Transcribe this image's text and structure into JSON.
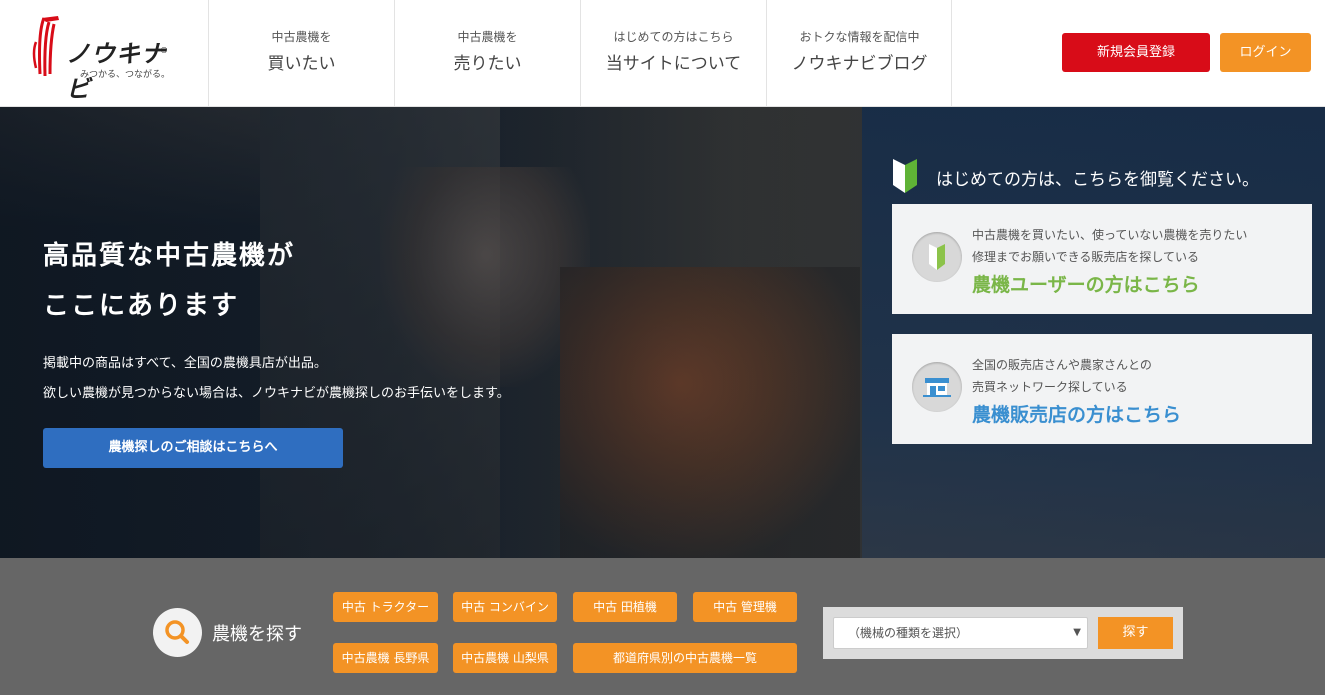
{
  "header": {
    "logo_text": "ノウキナビ",
    "logo_reg": "®",
    "logo_tagline": "みつかる、つながる。",
    "nav": [
      {
        "small": "中古農機を",
        "big": "買いたい"
      },
      {
        "small": "中古農機を",
        "big": "売りたい"
      },
      {
        "small": "はじめての方はこちら",
        "big": "当サイトについて"
      },
      {
        "small": "おトクな情報を配信中",
        "big": "ノウキナビブログ"
      }
    ],
    "register_label": "新規会員登録",
    "login_label": "ログイン"
  },
  "hero": {
    "title_line1": "高品質な中古農機が",
    "title_line2": "ここにあります",
    "desc_line1": "掲載中の商品はすべて、全国の農機具店が出品。",
    "desc_line2": "欲しい農機が見つからない場合は、ノウキナビが農機探しのお手伝いをします。",
    "cta_label": "農機探しのご相談はこちらへ",
    "welcome": "はじめての方は、こちらを御覧ください。",
    "cards": [
      {
        "line1": "中古農機を買いたい、使っていない農機を売りたい",
        "line2": "修理までお願いできる販売店を探している",
        "link": "農機ユーザーの方はこちら"
      },
      {
        "line1": "全国の販売店さんや農家さんとの",
        "line2": "売買ネットワーク探している",
        "link": "農機販売店の方はこちら"
      }
    ]
  },
  "search": {
    "label": "農機を探す",
    "tags": [
      "中古 トラクター",
      "中古 コンバイン",
      "中古 田植機",
      "中古 管理機",
      "中古農機 長野県",
      "中古農機 山梨県",
      "都道府県別の中古農機一覧"
    ],
    "select_value": "（機械の種類を選択）",
    "button_label": "探す"
  },
  "colors": {
    "brand_red": "#d80c18",
    "accent_orange": "#f39325",
    "cta_blue": "#2f6ec0",
    "link_green": "#7ab648",
    "link_blue": "#3a8fd0"
  }
}
